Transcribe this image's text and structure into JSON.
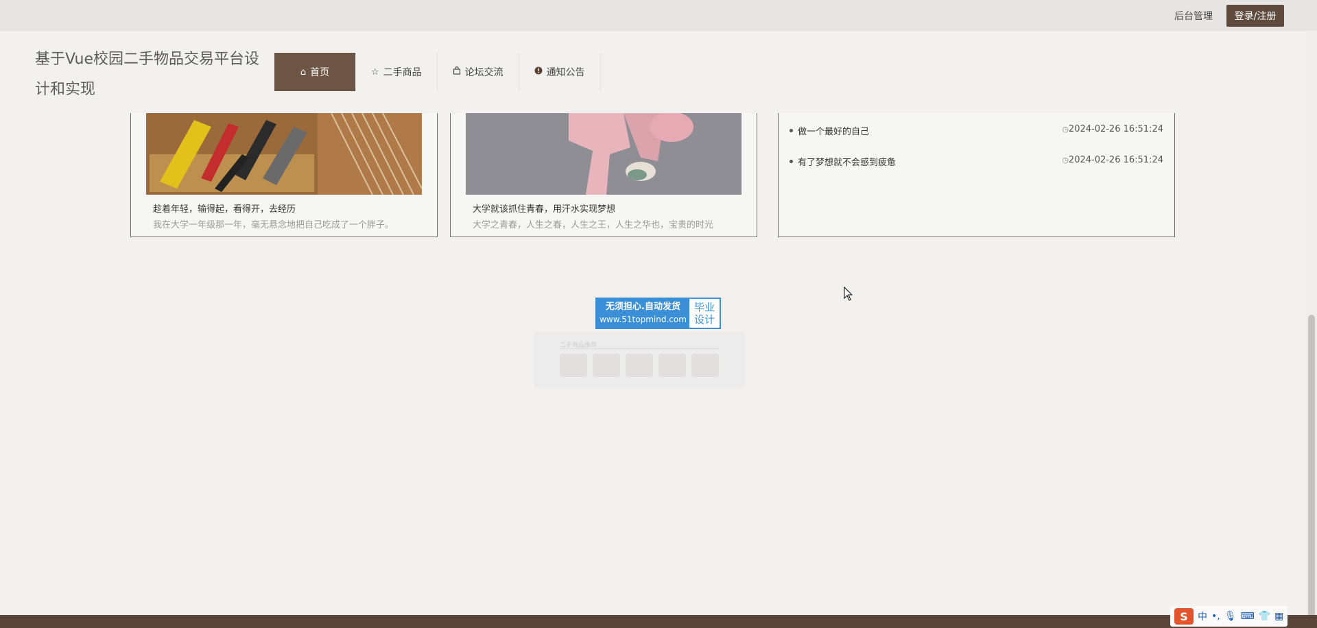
{
  "topbar": {
    "admin_label": "后台管理",
    "login_label": "登录/注册"
  },
  "header": {
    "site_title": "基于Vue校园二手物品交易平台设计和实现",
    "nav": [
      {
        "label": "首页",
        "icon": "home-icon",
        "active": true
      },
      {
        "label": "二手商品",
        "icon": "star-icon",
        "active": false
      },
      {
        "label": "论坛交流",
        "icon": "bag-icon",
        "active": false
      },
      {
        "label": "通知公告",
        "icon": "alert-icon",
        "active": false
      }
    ]
  },
  "cards": [
    {
      "title": "趁着年轻，输得起，看得开，去经历",
      "desc": "我在大学一年级那一年，毫无悬念地把自己吃成了一个胖子。"
    },
    {
      "title": "大学就该抓住青春，用汗水实现梦想",
      "desc": "大学之青春，人生之春，人生之王，人生之华也，宝贵的时光"
    }
  ],
  "news": [
    {
      "title": "做一个最好的自己",
      "date": "2024-02-26 16:51:24"
    },
    {
      "title": "有了梦想就不会感到疲惫",
      "date": "2024-02-26 16:51:24"
    }
  ],
  "ad": {
    "line1": "无须担心.自动发货",
    "line2": "www.51topmind.com",
    "right1": "毕业",
    "right2": "设计"
  },
  "ghost_panel": {
    "title": "二手商品推荐"
  },
  "ime": {
    "logo": "S",
    "lang": "中",
    "punct": "•,"
  },
  "colors": {
    "brand_brown": "#6d5545",
    "login_brown": "#5f4a3e",
    "ad_blue": "#3a8fd6"
  }
}
